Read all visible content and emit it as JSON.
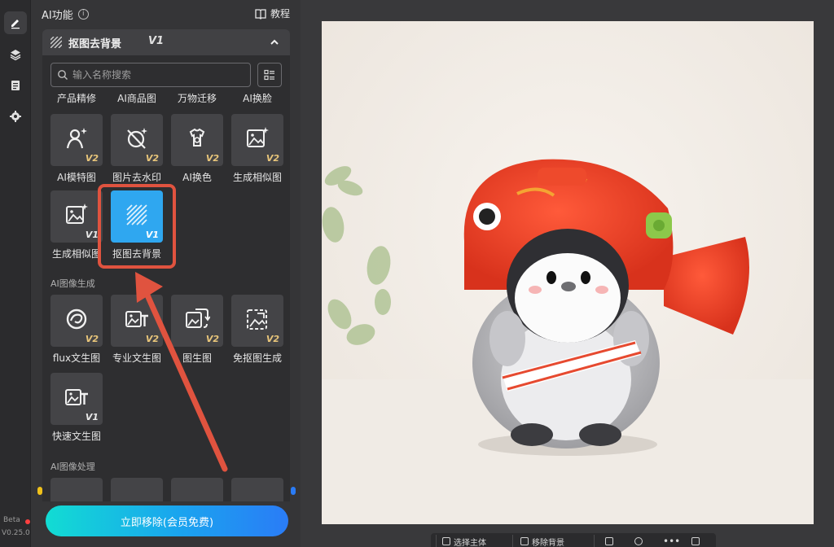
{
  "sidebar": {
    "items": [
      {
        "icon": "pencil-icon",
        "active": true
      },
      {
        "icon": "layers-icon",
        "active": false
      },
      {
        "icon": "clipboard-icon",
        "active": false
      },
      {
        "icon": "gear-icon",
        "active": false
      }
    ],
    "beta": "Beta",
    "version": "V0.25.0"
  },
  "panel": {
    "title": "AI功能",
    "info": "i",
    "tutorial": "教程",
    "section_title": "抠图去背景",
    "section_version": "V1",
    "search_placeholder": "输入名称搜索",
    "categories": [
      "产品精修",
      "AI商品图",
      "万物迁移",
      "AI换脸"
    ],
    "tools_row1": [
      {
        "label": "AI模特图",
        "badge": "V2",
        "icon": "person-sparkle-icon"
      },
      {
        "label": "图片去水印",
        "badge": "V2",
        "icon": "no-watermark-icon"
      },
      {
        "label": "AI换色",
        "badge": "V2",
        "icon": "shirt-palette-icon"
      },
      {
        "label": "生成相似图",
        "badge": "V2",
        "icon": "image-sparkle-icon"
      }
    ],
    "tools_row2": [
      {
        "label": "生成相似图",
        "badge": "V1",
        "icon": "image-sparkle-icon"
      },
      {
        "label": "抠图去背景",
        "badge": "V1",
        "icon": "hatch-icon",
        "selected": true
      }
    ],
    "group_gen": "AI图像生成",
    "tools_row3": [
      {
        "label": "flux文生图",
        "badge": "V2",
        "icon": "flux-swirl-icon"
      },
      {
        "label": "专业文生图",
        "badge": "V2",
        "icon": "image-text-icon"
      },
      {
        "label": "图生图",
        "badge": "V2",
        "icon": "image-refresh-icon"
      },
      {
        "label": "免抠图生成",
        "badge": "V2",
        "icon": "image-dashed-icon"
      }
    ],
    "tools_row4": [
      {
        "label": "快速文生图",
        "badge": "V1",
        "icon": "image-text-icon"
      }
    ],
    "group_process": "AI图像处理",
    "cta": "立即移除(会员免费)"
  },
  "canvas": {
    "bottom_bar": [
      "选择主体",
      "移除背景"
    ]
  },
  "colors": {
    "accent": "#2fa7f0",
    "highlight": "#e0533f",
    "badge": "#e8c57a"
  }
}
